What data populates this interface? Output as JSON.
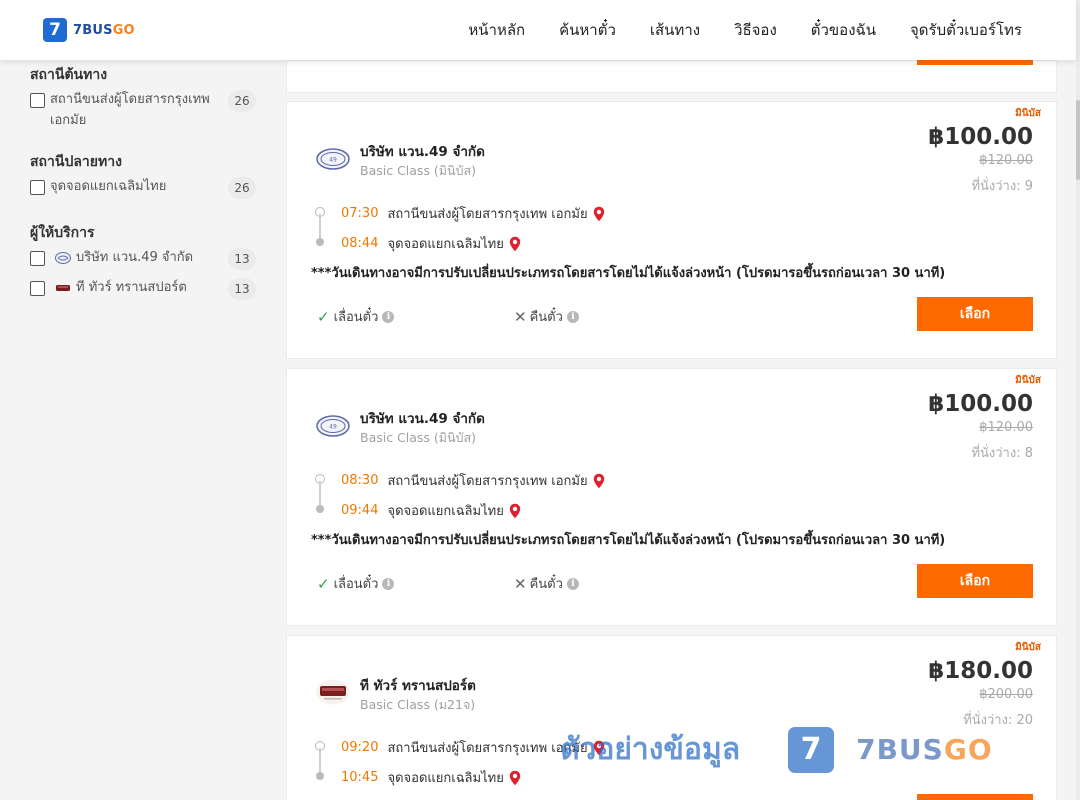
{
  "header": {
    "logo_digit": "7",
    "logo_text_a": "BUS",
    "logo_text_b": "GO",
    "nav": [
      "หน้าหลัก",
      "ค้นหาตั๋ว",
      "เส้นทาง",
      "วิธีจอง",
      "ตั๋วของฉัน",
      "จุดรับตั๋วเบอร์โทร"
    ]
  },
  "sidebar": {
    "origin_title": "สถานีต้นทาง",
    "origin_items": [
      {
        "label": "สถานีขนส่งผู้โดยสารกรุงเทพ เอกมัย",
        "count": "26"
      }
    ],
    "dest_title": "สถานีปลายทาง",
    "dest_items": [
      {
        "label": "จุดจอดแยกเฉลิมไทย",
        "count": "26"
      }
    ],
    "operator_title": "ผู้ให้บริการ",
    "operator_items": [
      {
        "label": "บริษัท แวน.49 จำกัด",
        "count": "13"
      },
      {
        "label": "ที ทัวร์ ทรานสปอร์ต",
        "count": "13"
      }
    ]
  },
  "trips": [
    {
      "badge": "มินิบัส",
      "operator": "บริษัท แวน.49 จำกัด",
      "class": "Basic Class (มินิบัส)",
      "price": "฿100.00",
      "old_price": "฿120.00",
      "seats": "ที่นั่งว่าง: 9",
      "depart_time": "07:30",
      "depart_station": "สถานีขนส่งผู้โดยสารกรุงเทพ เอกมัย",
      "arrive_time": "08:44",
      "arrive_station": "จุดจอดแยกเฉลิมไทย",
      "notice": "***วันเดินทางอาจมีการปรับเปลี่ยนประเภทรถโดยสารโดยไม่ได้แจ้งล่วงหน้า (โปรดมารอขึ้นรถก่อนเวลา 30 นาที)",
      "feature_1": "เลื่อนตั๋ว",
      "feature_2": "คืนตั๋ว",
      "select": "เลือก"
    },
    {
      "badge": "มินิบัส",
      "operator": "บริษัท แวน.49 จำกัด",
      "class": "Basic Class (มินิบัส)",
      "price": "฿100.00",
      "old_price": "฿120.00",
      "seats": "ที่นั่งว่าง: 8",
      "depart_time": "08:30",
      "depart_station": "สถานีขนส่งผู้โดยสารกรุงเทพ เอกมัย",
      "arrive_time": "09:44",
      "arrive_station": "จุดจอดแยกเฉลิมไทย",
      "notice": "***วันเดินทางอาจมีการปรับเปลี่ยนประเภทรถโดยสารโดยไม่ได้แจ้งล่วงหน้า (โปรดมารอขึ้นรถก่อนเวลา 30 นาที)",
      "feature_1": "เลื่อนตั๋ว",
      "feature_2": "คืนตั๋ว",
      "select": "เลือก"
    },
    {
      "badge": "มินิบัส",
      "operator": "ที ทัวร์ ทรานสปอร์ต",
      "class": "Basic Class (ม21จ)",
      "price": "฿180.00",
      "old_price": "฿200.00",
      "seats": "ที่นั่งว่าง: 20",
      "depart_time": "09:20",
      "depart_station": "สถานีขนส่งผู้โดยสารกรุงเทพ เอกมัย",
      "arrive_time": "10:45",
      "arrive_station": "จุดจอดแยกเฉลิมไทย"
    }
  ],
  "watermark": {
    "text": "ตัวอย่างข้อมูล",
    "mark": "7",
    "brand_a": "7BUS",
    "brand_b": "GO"
  },
  "colors": {
    "accent": "#ff6a00",
    "brand_blue": "#1f6bd6",
    "time": "#f07800"
  }
}
